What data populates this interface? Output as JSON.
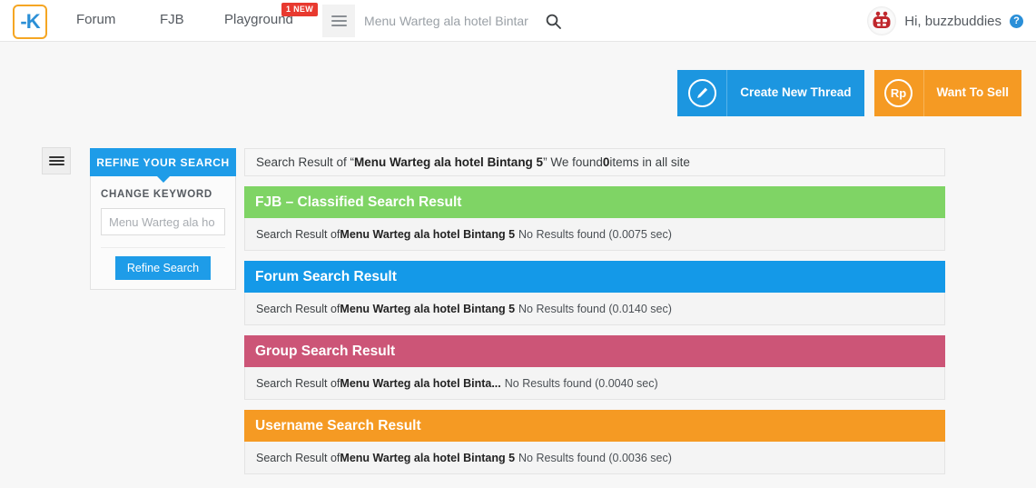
{
  "header": {
    "logo_glyph": "-K",
    "nav": [
      {
        "label": "Forum"
      },
      {
        "label": "FJB"
      },
      {
        "label": "Playground"
      }
    ],
    "new_badge": "1 NEW",
    "search": {
      "value": "Menu Warteg ala hotel Bintar",
      "placeholder": "Menu Warteg ala hotel Bintar"
    },
    "user": {
      "greeting": "Hi, buzzbuddies",
      "help_glyph": "?"
    }
  },
  "actions": [
    {
      "label": "Create New Thread",
      "icon": "pencil-icon",
      "color": "#1c96e0"
    },
    {
      "label": "Want To Sell",
      "icon": "rp-icon",
      "icon_text": "Rp",
      "color": "#f59a23"
    }
  ],
  "sidebar": {
    "title": "REFINE YOUR SEARCH",
    "change_keyword_label": "CHANGE KEYWORD",
    "keyword_input": {
      "value": "Menu Warteg ala ho",
      "placeholder": "Menu Warteg ala ho"
    },
    "refine_button": "Refine Search"
  },
  "main": {
    "summary": {
      "prefix": "Search Result of “",
      "query": "Menu Warteg ala hotel Bintang 5",
      "middle": "” We found ",
      "count": "0",
      "suffix": " items in all site"
    },
    "panels": [
      {
        "title": "FJB – Classified Search Result",
        "color": "#7fd465",
        "prefix": "Search Result of ",
        "query": "Menu Warteg ala hotel Bintang 5",
        "status": "No Results found (0.0075 sec)"
      },
      {
        "title": "Forum Search Result",
        "color": "#1499e8",
        "prefix": "Search Result of ",
        "query": "Menu Warteg ala hotel Bintang 5",
        "status": "No Results found (0.0140 sec)"
      },
      {
        "title": "Group Search Result",
        "color": "#cc5577",
        "prefix": "Search Result of ",
        "query": "Menu Warteg ala hotel Binta...",
        "status": "No Results found (0.0040 sec)"
      },
      {
        "title": "Username Search Result",
        "color": "#f59a23",
        "prefix": "Search Result of ",
        "query": "Menu Warteg ala hotel Bintang 5",
        "status": "No Results found (0.0036 sec)"
      }
    ]
  }
}
